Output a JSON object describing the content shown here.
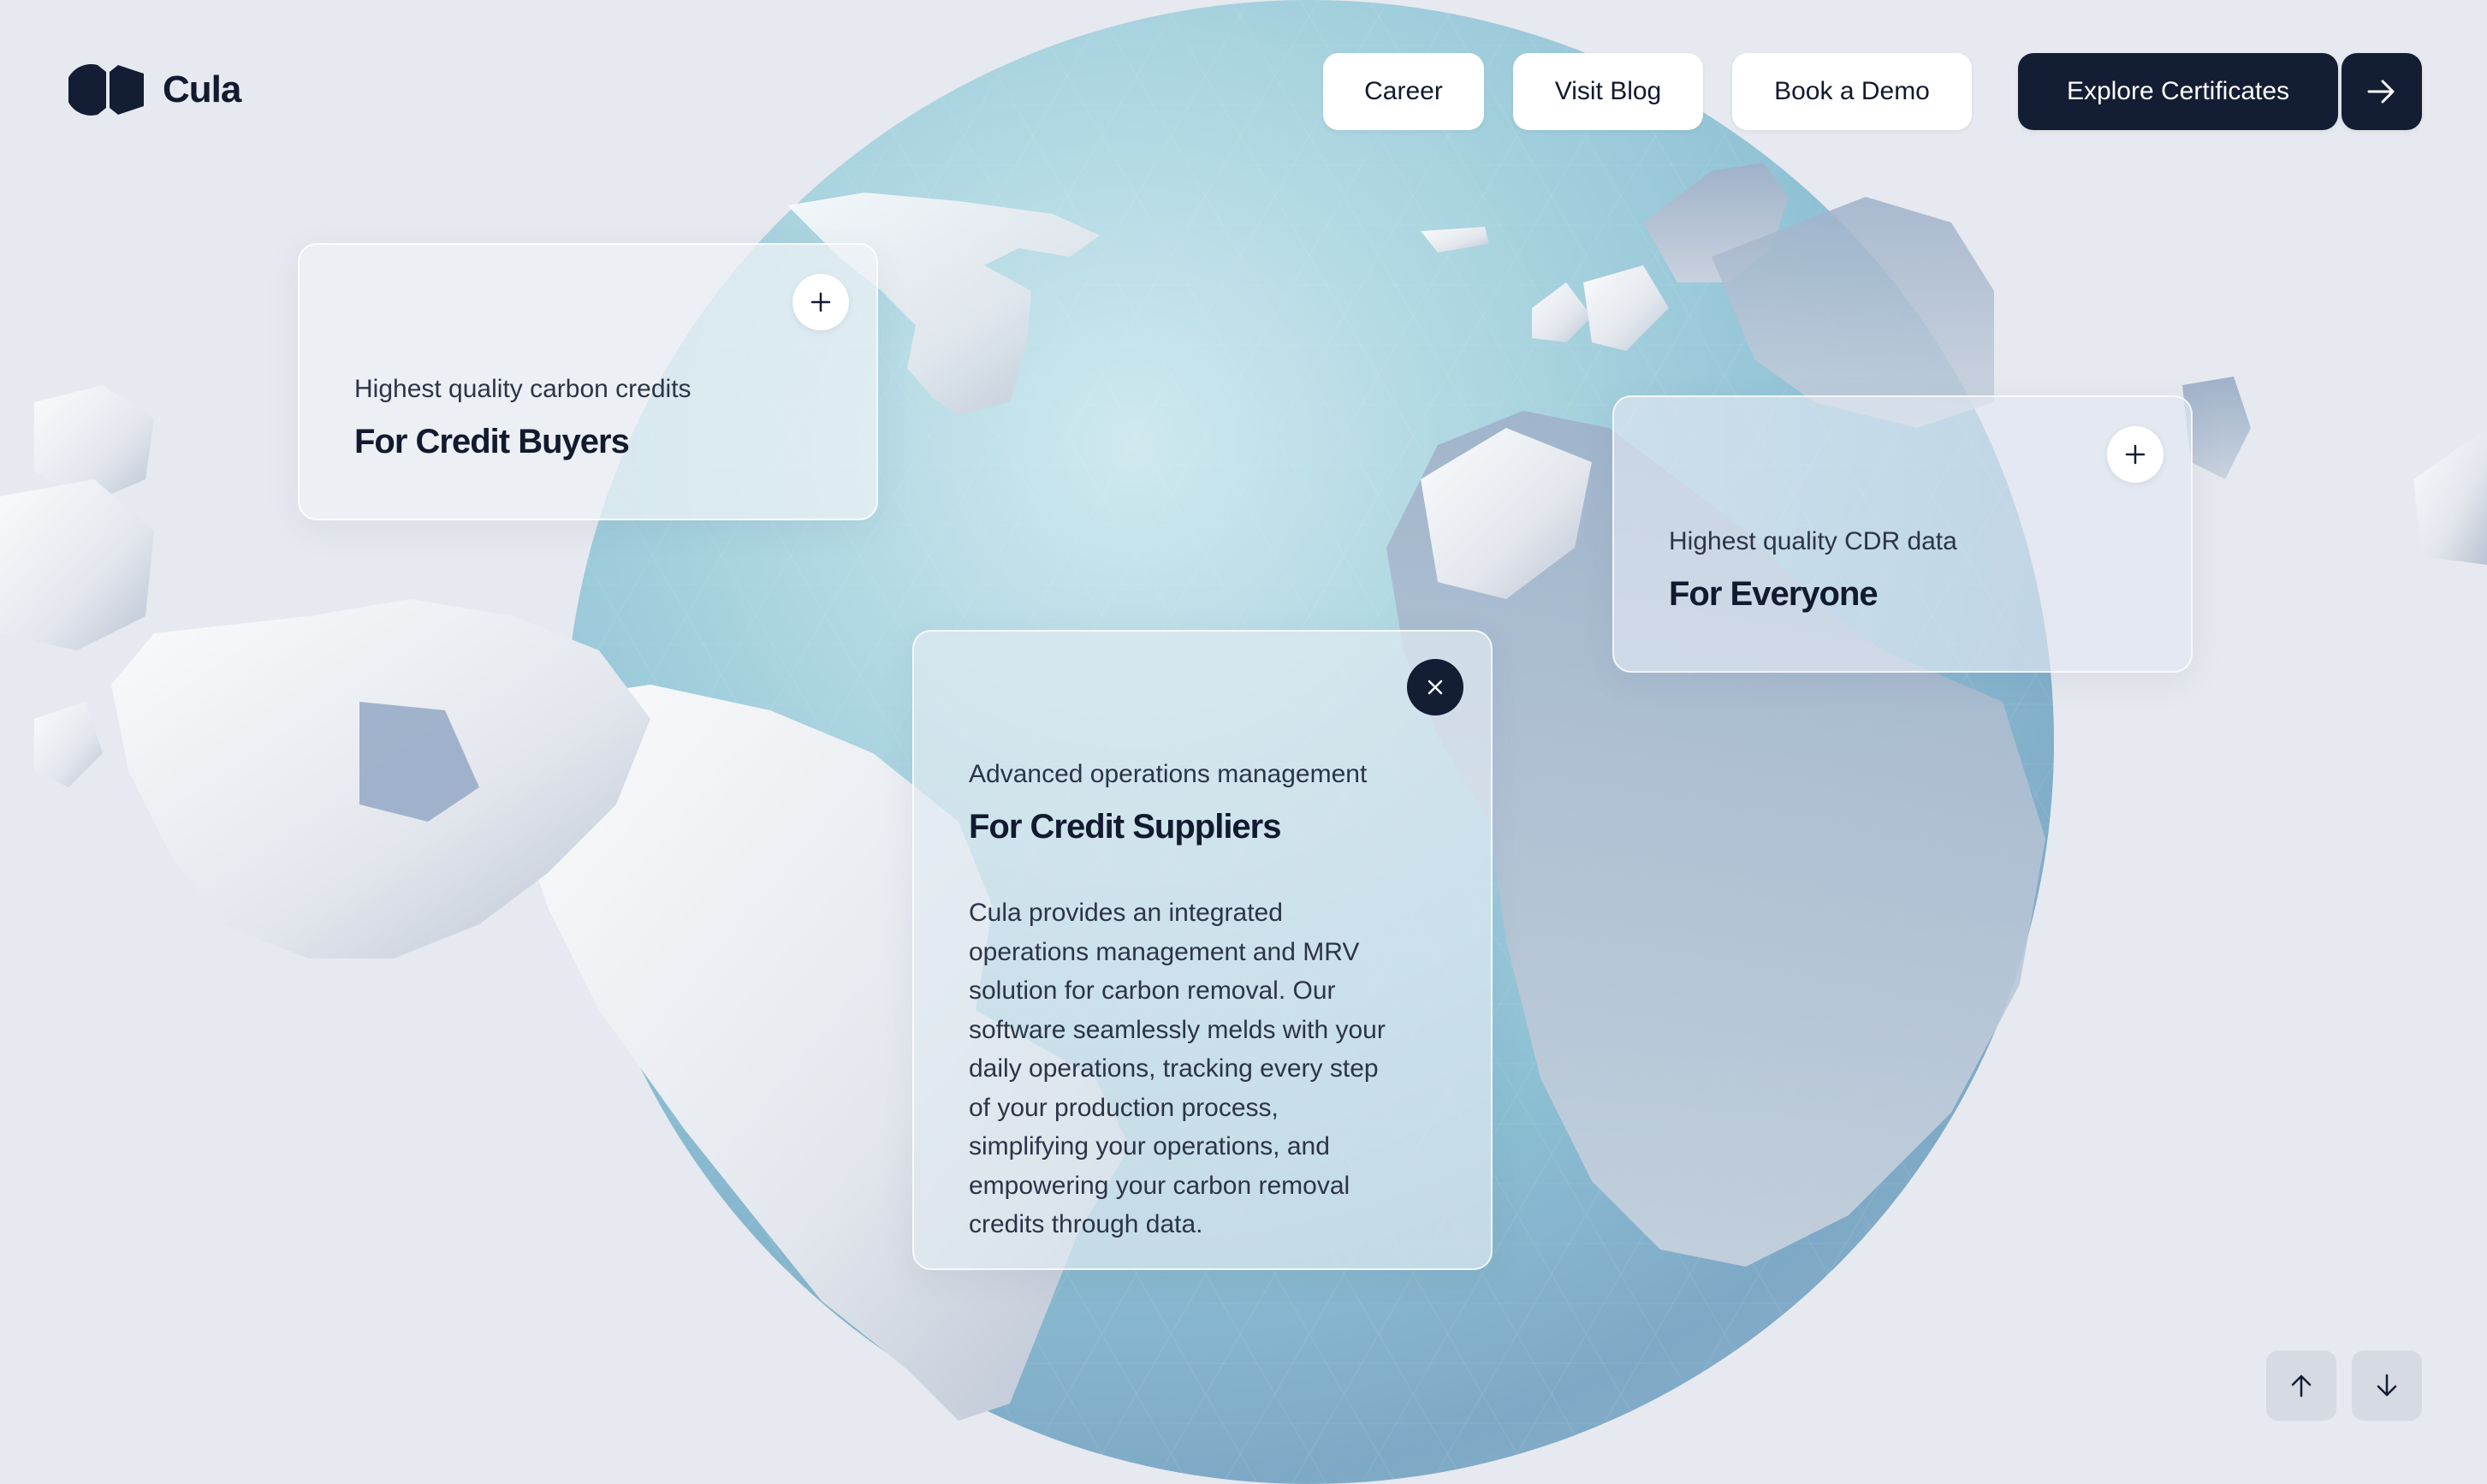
{
  "brand": {
    "name": "Cula",
    "logo_icon": "cula-logo-icon"
  },
  "nav": {
    "career": "Career",
    "blog": "Visit Blog",
    "demo": "Book a Demo",
    "explore": "Explore Certificates",
    "explore_icon": "arrow-right-icon"
  },
  "cards": {
    "buyers": {
      "kicker": "Highest quality carbon credits",
      "title": "For Credit Buyers",
      "toggle_icon": "plus-icon"
    },
    "everyone": {
      "kicker": "Highest quality CDR data",
      "title": "For Everyone",
      "toggle_icon": "plus-icon"
    },
    "suppliers": {
      "kicker": "Advanced operations management",
      "title": "For Credit Suppliers",
      "toggle_icon": "close-icon",
      "body": [
        "Cula provides an integrated",
        "operations management and MRV",
        "solution for carbon removal. Our",
        "software seamlessly melds with your",
        "daily operations, tracking every step",
        "of your production process,",
        "simplifying your operations, and",
        "empowering your carbon removal",
        "credits through data."
      ]
    }
  },
  "scroll": {
    "up_icon": "arrow-up-icon",
    "down_icon": "arrow-down-icon"
  },
  "colors": {
    "accent_dark": "#131d33",
    "background": "#e6e9ef",
    "globe": "#9ccbd9"
  }
}
